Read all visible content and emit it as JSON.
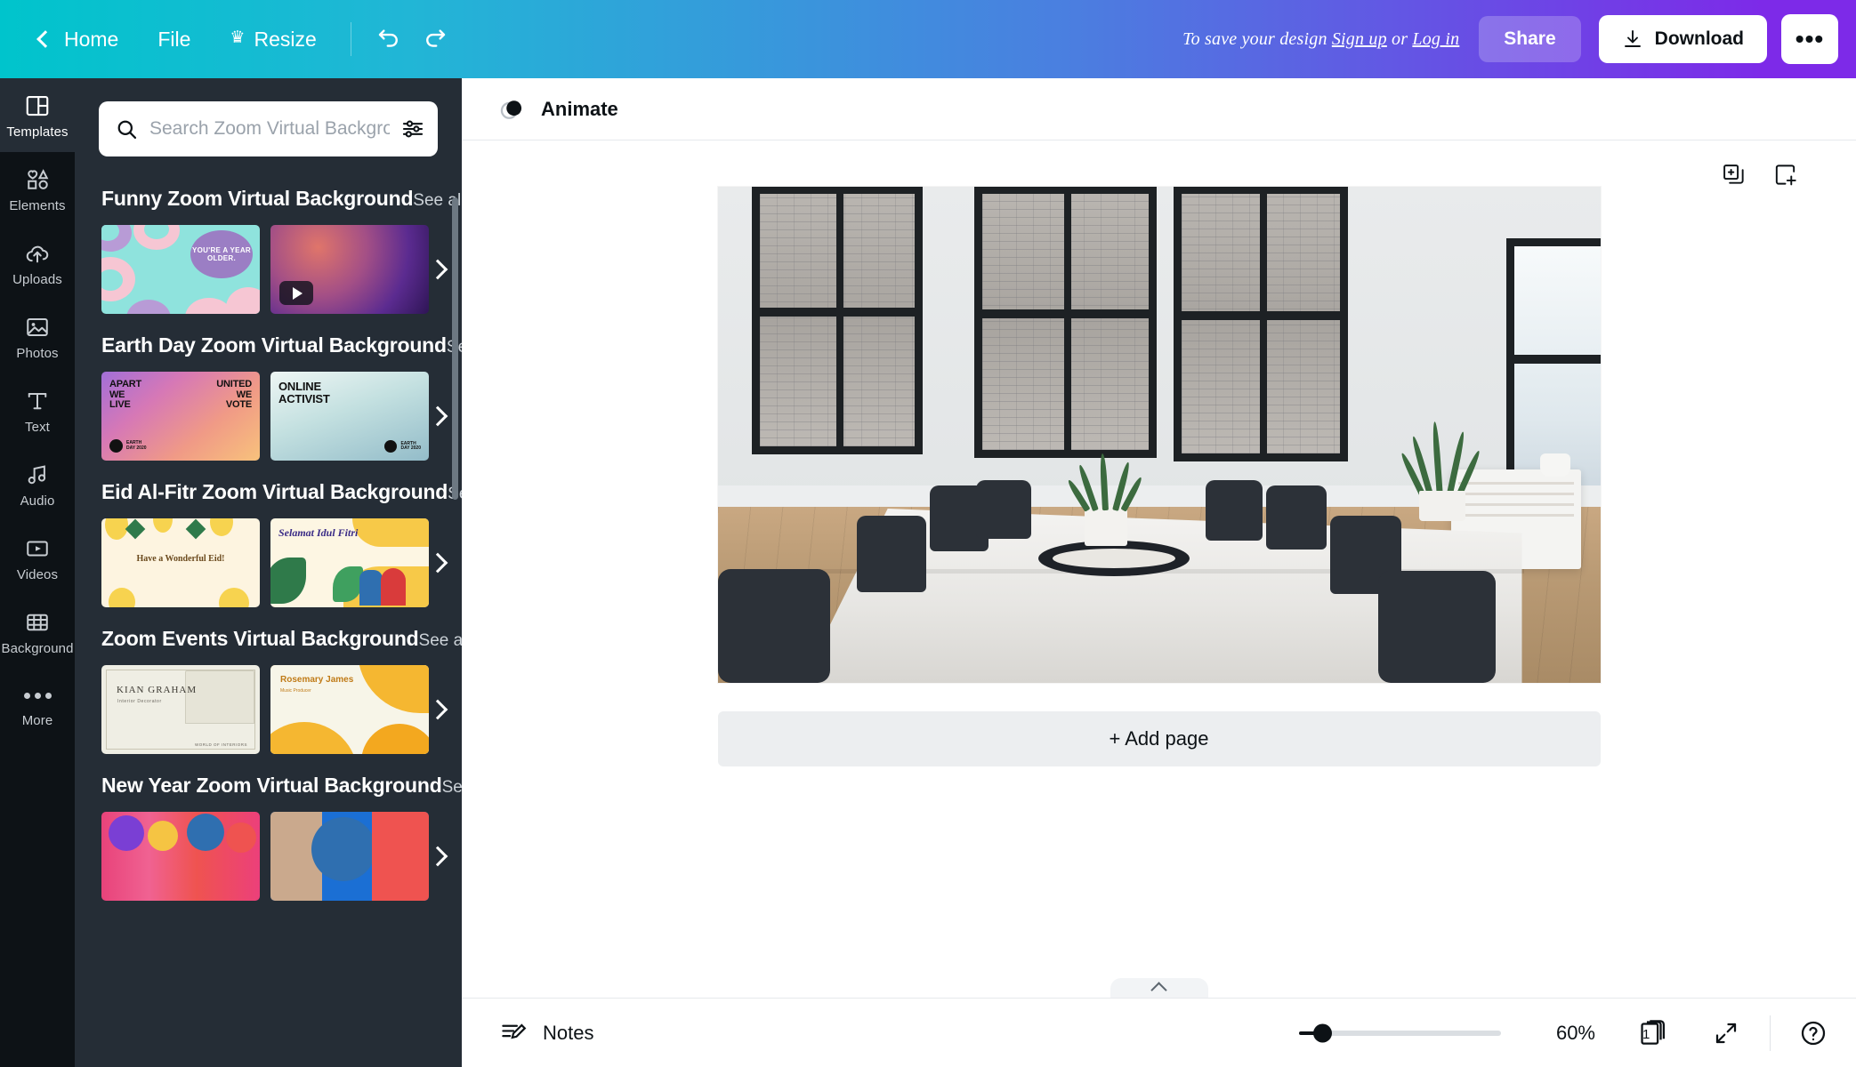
{
  "topbar": {
    "back_label": "",
    "home_label": "Home",
    "file_label": "File",
    "resize_label": "Resize",
    "resize_crown": "♛",
    "undo_icon": "undo-icon",
    "redo_icon": "redo-icon",
    "save_prefix": "To save your design ",
    "signup_label": "Sign up",
    "or_label": " or ",
    "login_label": "Log in",
    "share_label": "Share",
    "download_label": "Download",
    "more_label": "•••",
    "gradient_start": "#00c4cc",
    "gradient_end": "#7d2ae8"
  },
  "rail": {
    "items": [
      {
        "label": "Templates",
        "icon": "templates-icon",
        "active": true
      },
      {
        "label": "Elements",
        "icon": "elements-icon",
        "active": false
      },
      {
        "label": "Uploads",
        "icon": "uploads-icon",
        "active": false
      },
      {
        "label": "Photos",
        "icon": "photos-icon",
        "active": false
      },
      {
        "label": "Text",
        "icon": "text-icon",
        "active": false
      },
      {
        "label": "Audio",
        "icon": "audio-icon",
        "active": false
      },
      {
        "label": "Videos",
        "icon": "videos-icon",
        "active": false
      },
      {
        "label": "Background",
        "icon": "background-icon",
        "active": false
      },
      {
        "label": "More",
        "icon": "more-dots-icon",
        "active": false
      }
    ]
  },
  "panel": {
    "search": {
      "placeholder": "Search Zoom Virtual Background templates",
      "value": "",
      "search_icon": "search-icon",
      "filter_icon": "filter-icon"
    },
    "see_all_label": "See all",
    "sections": [
      {
        "title": "Funny Zoom Virtual Background",
        "thumbs": [
          {
            "name": "donut-birthday-template",
            "style": "donut",
            "text": "YOU'RE A YEAR OLDER."
          },
          {
            "name": "galaxy-template",
            "style": "galaxy",
            "video": true,
            "text": ""
          }
        ]
      },
      {
        "title": "Earth Day Zoom Virtual Background",
        "thumbs": [
          {
            "name": "apart-we-live-template",
            "style": "earth1",
            "text_left": "APART WE LIVE",
            "text_right": "UNITED WE VOTE",
            "brand": "EARTH DAY 2020",
            "sub": "ONLINE ACTIVIST"
          },
          {
            "name": "online-activist-template",
            "style": "earth2",
            "text": "ONLINE ACTIVIST",
            "brand": "EARTH DAY 2020"
          }
        ]
      },
      {
        "title": "Eid Al-Fitr Zoom Virtual Background",
        "thumbs": [
          {
            "name": "have-a-wonderful-eid-template",
            "style": "eid1",
            "text": "Have a Wonderful Eid!"
          },
          {
            "name": "selamat-idul-fitri-template",
            "style": "eid2",
            "text": "Selamat Idul Fitri"
          }
        ]
      },
      {
        "title": "Zoom Events Virtual Background",
        "thumbs": [
          {
            "name": "kian-graham-template",
            "style": "event1",
            "text": "KIAN GRAHAM",
            "sub": "Interior Decorator",
            "corner": "WORLD OF INTERIORS"
          },
          {
            "name": "rosemary-james-template",
            "style": "event2",
            "text": "Rosemary James",
            "sub": "Music Producer"
          }
        ]
      },
      {
        "title": "New Year Zoom Virtual Background",
        "thumbs": [
          {
            "name": "new-year-party-template",
            "style": "ny1",
            "text": ""
          },
          {
            "name": "new-year-blue-template",
            "style": "ny2",
            "text": ""
          }
        ]
      }
    ]
  },
  "main": {
    "animate_label": "Animate",
    "animate_icon": "animate-circles-icon",
    "duplicate_page_icon": "duplicate-page-icon",
    "add_page_icon": "add-page-icon",
    "add_page_label": "+ Add page",
    "canvas": {
      "name": "office-conference-room-photo"
    }
  },
  "bottombar": {
    "notes_label": "Notes",
    "notes_icon": "notes-pencil-icon",
    "zoom_minus_icon": "zoom-out-icon",
    "zoom_percent": "60%",
    "zoom_value": 60,
    "page_count": "1",
    "pages_icon": "pages-icon",
    "expand_icon": "expand-icon",
    "help_icon": "help-icon"
  }
}
